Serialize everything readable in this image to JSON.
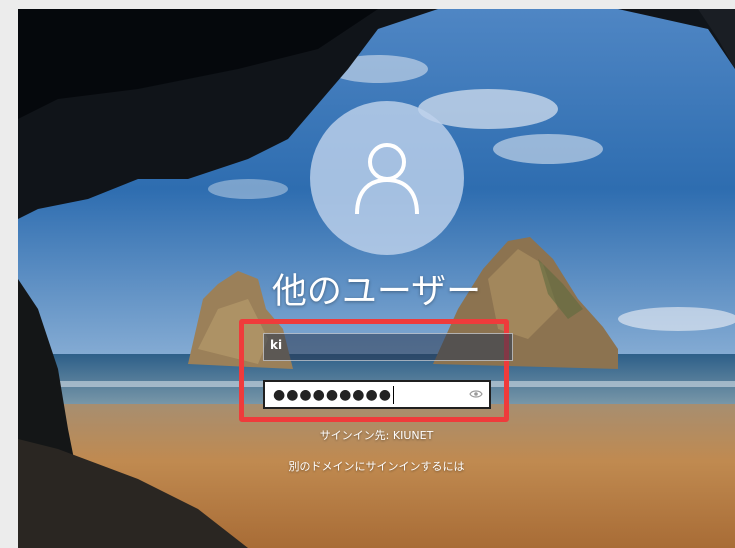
{
  "login": {
    "user_name": "他のユーザー",
    "username_value": "ki",
    "password_mask": "●●●●●●●●●",
    "sign_in_to": "サインイン先: KIUNET",
    "other_domain_link": "別のドメインにサインインするには"
  },
  "icons": {
    "avatar": "user-icon",
    "reveal": "eye-icon"
  },
  "colors": {
    "highlight": "#ef3b3b",
    "avatar_bg": "#bed2eb"
  }
}
